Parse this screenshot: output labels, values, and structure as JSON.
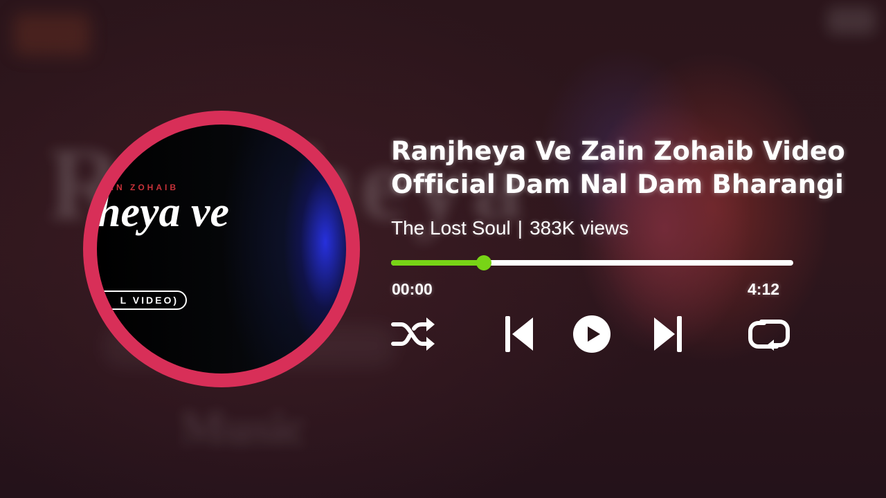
{
  "track": {
    "title_line1": "Ranjheya Ve Zain Zohaib Video",
    "title_line2": "Official Dam Nal Dam Bharangi",
    "channel": "The Lost Soul",
    "separator": "|",
    "views": "383K views"
  },
  "artwork": {
    "brand": "AIN ZOHAIB",
    "title": "heya ve",
    "pill": "L VIDEO)"
  },
  "player": {
    "current_time": "00:00",
    "duration": "4:12",
    "progress": 0.23
  },
  "controls": {
    "shuffle_icon": "shuffle-icon",
    "previous_icon": "skip-previous-icon",
    "play_icon": "play-icon",
    "next_icon": "skip-next-icon",
    "repeat_icon": "repeat-icon"
  },
  "colors": {
    "accent_progress": "#78d416",
    "disc_ring": "#d82f58",
    "text": "#ffffff"
  }
}
